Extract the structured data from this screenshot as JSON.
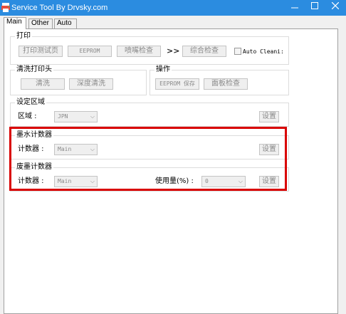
{
  "window": {
    "title": "Service Tool By Drvsky.com"
  },
  "tabs": [
    {
      "label": "Main",
      "active": true
    },
    {
      "label": "Other",
      "active": false
    },
    {
      "label": "Auto",
      "active": false
    }
  ],
  "print": {
    "title": "打印",
    "test_page": "打印测试页",
    "eeprom": "EEPROM",
    "nozzle_check": "喷嘴检查",
    "arrows": ">>",
    "combined_check": "综合检查",
    "auto_clean": "Auto Cleani:"
  },
  "clean_head": {
    "title": "清洗打印头",
    "clean": "清洗",
    "deep_clean": "深度清洗"
  },
  "operation": {
    "title": "操作",
    "eeprom_save": "EEPROM 保存",
    "panel_check": "面板检查"
  },
  "region": {
    "title": "设定区域",
    "label": "区域 :",
    "value": "JPN",
    "set": "设置"
  },
  "ink_counter": {
    "title": "墨水计数器",
    "label": "计数器 :",
    "value": "Main",
    "set": "设置"
  },
  "waste_counter": {
    "title": "废墨计数器",
    "label": "计数器 :",
    "value": "Main",
    "usage_label": "使用量(%) :",
    "usage_value": "0",
    "set": "设置"
  },
  "colors": {
    "titlebar": "#2b8ce0",
    "highlight": "#d90000"
  }
}
